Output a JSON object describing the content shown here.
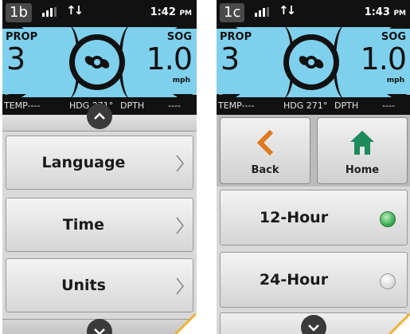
{
  "colors": {
    "gauge_bg": "#7fd0ec",
    "status_bg": "#111111",
    "menu_bg": "#d9d9d9",
    "accent_back": "#e07a1f",
    "accent_home": "#1f8a5c",
    "radio_on": "#2fa14a",
    "corner_edge": "#f0b23c"
  },
  "screens": [
    {
      "badge": "1b",
      "time": "1:42",
      "ampm": "PM",
      "prop_label": "PROP",
      "prop_value": "3",
      "sog_label": "SOG",
      "sog_value": "1.0",
      "sog_unit": "mph",
      "temp": "TEMP----",
      "hdg": "HDG 271°",
      "dpth": "DPTH",
      "dpth_val": "----",
      "menu": [
        {
          "label": "Language",
          "icon": "chevron-right-icon"
        },
        {
          "label": "Time",
          "icon": "chevron-right-icon"
        },
        {
          "label": "Units",
          "icon": "chevron-right-icon"
        }
      ]
    },
    {
      "badge": "1c",
      "time": "1:43",
      "ampm": "PM",
      "prop_label": "PROP",
      "prop_value": "3",
      "sog_label": "SOG",
      "sog_value": "1.0",
      "sog_unit": "mph",
      "temp": "TEMP----",
      "hdg": "HDG 271°",
      "dpth": "DPTH",
      "dpth_val": "----",
      "nav": {
        "back": "Back",
        "home": "Home"
      },
      "options": [
        {
          "label": "12-Hour",
          "selected": true
        },
        {
          "label": "24-Hour",
          "selected": false
        }
      ]
    }
  ]
}
